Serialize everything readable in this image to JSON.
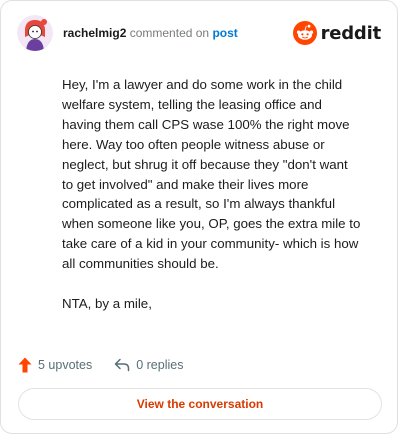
{
  "header": {
    "username": "rachelmig2",
    "verb": "commented on",
    "post_link": "post",
    "brand": "reddit"
  },
  "comment": {
    "paragraphs": [
      "Hey, I'm a lawyer and do some work in the child welfare system, telling the leasing office and having them call CPS wase 100% the right move here. Way too often people witness abuse or neglect, but shrug it off because they \"don't want to get involved\" and make their lives more complicated as a result, so I'm always thankful when someone like you, OP, goes the extra mile to take care of a kid in your community- which is how all communities should be.",
      "NTA, by a mile,"
    ]
  },
  "actions": {
    "upvotes": "5 upvotes",
    "replies": "0 replies"
  },
  "footer": {
    "button_label": "View the conversation"
  },
  "colors": {
    "brand_orange": "#ff4500",
    "link_blue": "#0079d3",
    "button_text": "#d93a00"
  },
  "icons": [
    "avatar",
    "reddit-logo-icon",
    "upvote-icon",
    "reply-icon"
  ]
}
